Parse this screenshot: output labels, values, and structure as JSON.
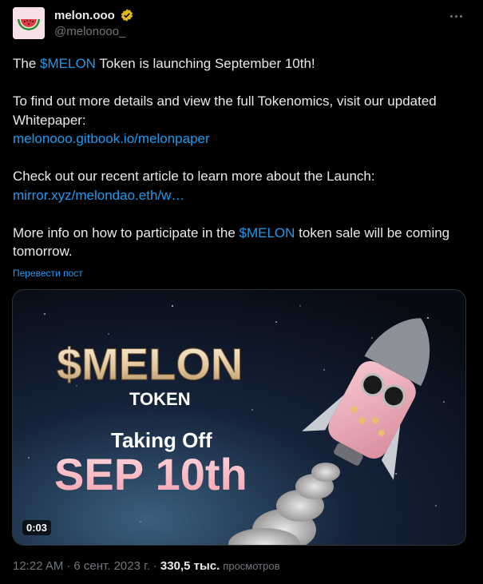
{
  "author": {
    "display_name": "melon.ooo",
    "handle": "@melonooo_",
    "verified_color": "#e2b719",
    "avatar_icon": "watermelon-icon"
  },
  "post": {
    "line1_pre": "The ",
    "line1_cashtag": "$MELON",
    "line1_post": " Token is launching September 10th!",
    "para2": "To find out more details and view the full Tokenomics, visit our updated Whitepaper:",
    "link1": "melonooo.gitbook.io/melonpaper",
    "para3": "Check out our recent article to learn more about the Launch:",
    "link2": "mirror.xyz/melondao.eth/w…",
    "para4_pre": "More info on how to participate in the ",
    "para4_cashtag": "$MELON",
    "para4_post": " token sale will be coming tomorrow.",
    "translate": "Перевести пост"
  },
  "media": {
    "title": "$MELON",
    "subtitle": "TOKEN",
    "taking_off": "Taking Off",
    "date": "SEP 10th",
    "duration": "0:03"
  },
  "meta": {
    "time": "12:22 AM",
    "date": "6 сент. 2023 г.",
    "views": "330,5 тыс.",
    "views_label": "просмотров"
  },
  "colors": {
    "accent": "#1d9bf0",
    "background": "#000000",
    "text": "#e7e9ea",
    "muted": "#71767b"
  }
}
